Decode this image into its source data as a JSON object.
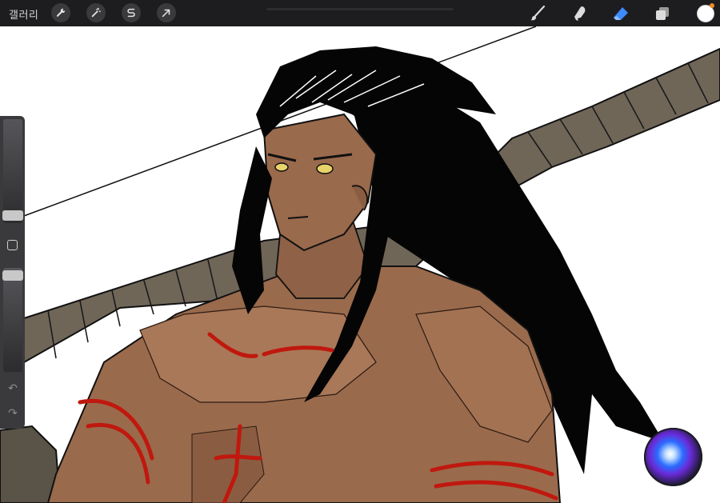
{
  "app": {
    "gallery_label": "갤러리",
    "accent_color": "#3d8bff",
    "current_color": "#ffffff"
  },
  "toolbar_left": [
    {
      "name": "wrench-icon",
      "meaning": "actions"
    },
    {
      "name": "magic-wand-icon",
      "meaning": "adjustments"
    },
    {
      "name": "selection-s-icon",
      "meaning": "selection"
    },
    {
      "name": "arrow-cursor-icon",
      "meaning": "transform"
    }
  ],
  "toolbar_right": [
    {
      "name": "brush-icon",
      "meaning": "paint",
      "active": false
    },
    {
      "name": "smudge-icon",
      "meaning": "smudge",
      "active": false
    },
    {
      "name": "eraser-icon",
      "meaning": "erase",
      "active": true
    },
    {
      "name": "layers-icon",
      "meaning": "layers",
      "active": false
    }
  ],
  "sidebar": {
    "brush_size_level": 0.42,
    "opacity_level": 0.85,
    "undo_icon": "↶",
    "redo_icon": "↷"
  },
  "canvas": {
    "skin_color": "#9a6a4c",
    "hair_color": "#050505",
    "rope_color": "#6f6658",
    "mark_color": "#c0180e",
    "eye_color": "#e8d26a"
  }
}
